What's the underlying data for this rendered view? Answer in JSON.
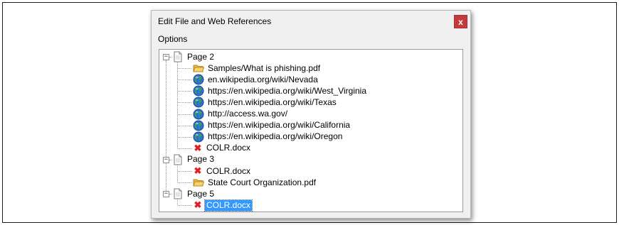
{
  "dialog": {
    "title": "Edit File and Web References",
    "close_label": "x",
    "menu": {
      "options_label": "Options"
    }
  },
  "tree": {
    "pages": [
      {
        "label": "Page 2",
        "children": [
          {
            "icon": "folder-icon",
            "label": "Samples/What is phishing.pdf"
          },
          {
            "icon": "globe-icon",
            "label": "en.wikipedia.org/wiki/Nevada"
          },
          {
            "icon": "globe-icon",
            "label": "https://en.wikipedia.org/wiki/West_Virginia"
          },
          {
            "icon": "globe-icon",
            "label": "https://en.wikipedia.org/wiki/Texas"
          },
          {
            "icon": "globe-icon",
            "label": "http://access.wa.gov/"
          },
          {
            "icon": "globe-icon",
            "label": "https://en.wikipedia.org/wiki/California"
          },
          {
            "icon": "globe-icon",
            "label": "https://en.wikipedia.org/wiki/Oregon"
          },
          {
            "icon": "broken-link-icon",
            "label": "COLR.docx"
          }
        ]
      },
      {
        "label": "Page 3",
        "children": [
          {
            "icon": "broken-link-icon",
            "label": "COLR.docx"
          },
          {
            "icon": "folder-icon",
            "label": "State Court Organization.pdf"
          }
        ]
      },
      {
        "label": "Page 5",
        "children": [
          {
            "icon": "broken-link-icon",
            "label": "COLR.docx",
            "selected": true
          }
        ]
      }
    ]
  },
  "colors": {
    "close_button": "#c43b3b",
    "selection": "#3399ff",
    "broken_link": "#e02020"
  }
}
